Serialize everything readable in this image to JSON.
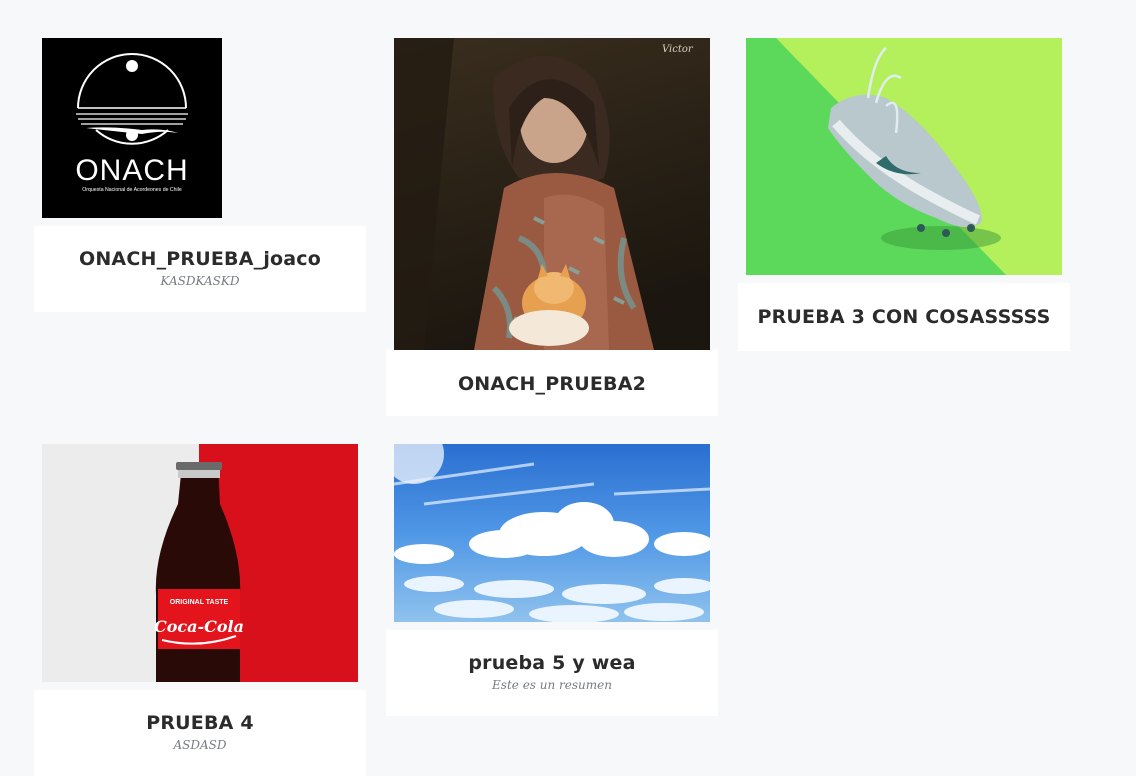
{
  "posts": [
    {
      "title": "ONACH_PRUEBA_joaco",
      "summary": "KASDKASKD",
      "image": "onach-logo",
      "logo": {
        "name": "ONACH",
        "tagline": "Orquesta Nacional de Acordeones de Chile"
      }
    },
    {
      "title": "ONACH_PRUEBA2",
      "summary": "",
      "image": "painting-girl-with-cat",
      "signature": "Victor"
    },
    {
      "title": "PRUEBA 3 CON COSASSSSS",
      "summary": "",
      "image": "sneaker-on-green"
    },
    {
      "title": "PRUEBA 4",
      "summary": "ASDASD",
      "image": "coca-cola-bottle",
      "label": {
        "top": "ORIGINAL TASTE",
        "brand": "Coca-Cola"
      }
    },
    {
      "title": "prueba 5 y wea",
      "summary": "Este es un resumen",
      "image": "sky-with-clouds"
    }
  ],
  "colors": {
    "background": "#f7f8f9",
    "card": "#ffffff",
    "title": "#2b2b2b",
    "summary": "#777c82"
  }
}
